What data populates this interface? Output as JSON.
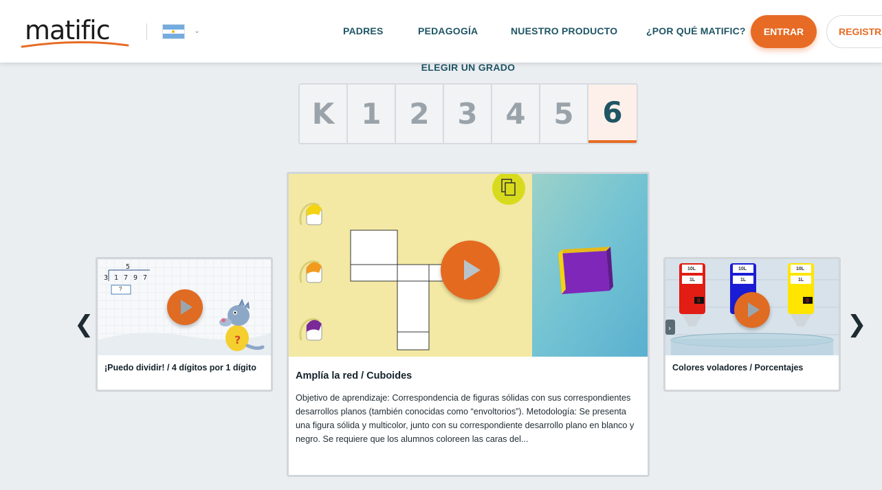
{
  "header": {
    "logo_text": "matific",
    "nav": [
      "PADRES",
      "PEDAGOGÍA",
      "NUESTRO PRODUCTO",
      "¿POR QUÉ MATIFIC?"
    ],
    "login_label": "ENTRAR",
    "register_label": "REGISTRA",
    "country_flag": "argentina-flag-icon"
  },
  "grade_selector": {
    "title": "ELEGIR UN GRADO",
    "grades": [
      "K",
      "1",
      "2",
      "3",
      "4",
      "5",
      "6"
    ],
    "selected": "6"
  },
  "carousel": {
    "prev_icon": "chevron-left-icon",
    "next_icon": "chevron-right-icon",
    "left_card": {
      "title": "¡Puedo dividir! / 4 dígitos por 1 dígito",
      "image": {
        "quotient": "5",
        "divisor": "3",
        "dividend": [
          "1",
          "7",
          "9",
          "7"
        ],
        "box": "?"
      }
    },
    "center_card": {
      "title": "Amplía la red / Cuboides",
      "description": "Objetivo de aprendizaje: Correspondencia de figuras sólidas con sus correspondientes desarrollos planos (también conocidas como “envoltorios”). Metodología: Se presenta una figura sólida y multicolor, junto con su correspondiente desarrollo plano en blanco y negro. Se requiere que los alumnos coloreen las caras del..."
    },
    "right_card": {
      "title": "Colores voladores / Porcentajes",
      "image": {
        "labels": [
          "10L",
          "1L",
          "10L",
          "1L",
          "10L",
          "1L"
        ],
        "readout": "0"
      }
    }
  },
  "colors": {
    "accent": "#e76b24",
    "nav_text": "#1f5565",
    "background": "#ebeef1"
  }
}
